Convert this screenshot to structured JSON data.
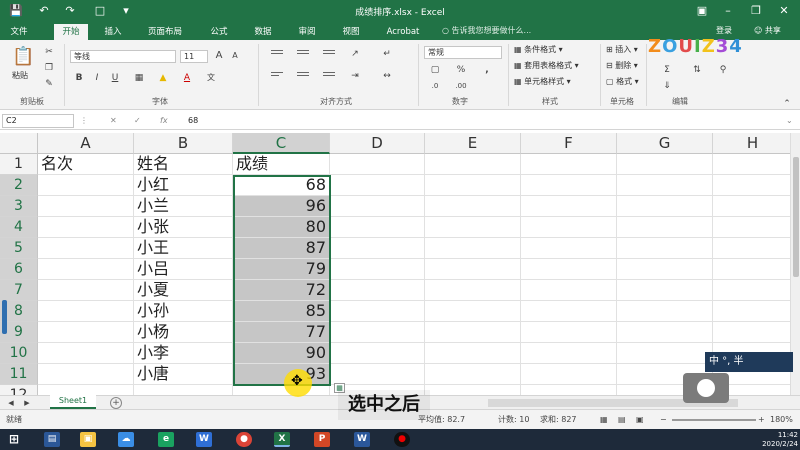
{
  "window": {
    "title": "成绩排序.xlsx - Excel",
    "quick_access": [
      "save-icon",
      "undo-icon",
      "redo-icon",
      "new-doc-icon",
      "customize-icon"
    ],
    "controls": [
      "ribbon-display-icon",
      "minimize-icon",
      "restore-icon",
      "close-icon"
    ]
  },
  "tabs": {
    "items": [
      "文件",
      "开始",
      "插入",
      "页面布局",
      "公式",
      "数据",
      "审阅",
      "视图",
      "Acrobat"
    ],
    "active": "开始",
    "tell_me": "告诉我您想要做什么...",
    "login": "登录",
    "share": "共享"
  },
  "ribbon": {
    "paste_label": "粘贴",
    "clipboard_label": "剪贴板",
    "font_name": "等线",
    "font_size": "11",
    "font_group_label": "字体",
    "bold": "B",
    "italic": "I",
    "underline": "U",
    "grow_font": "A",
    "shrink_font": "A",
    "font_color": "A",
    "alignment_label": "对齐方式",
    "number_format": "常规",
    "number_label": "数字",
    "percent": "%",
    "comma": ",",
    "cond_format": "条件格式",
    "table_format": "套用表格格式",
    "cell_styles": "单元格样式",
    "styles_label": "样式",
    "insert": "插入",
    "delete": "删除",
    "format": "格式",
    "cells_label": "单元格",
    "editing_label": "编辑",
    "accent_color": "#217346"
  },
  "logo": "ZOUIZ34",
  "formula_bar": {
    "name_box": "C2",
    "cancel": "✕",
    "enter": "✓",
    "fx": "fx",
    "value": "68"
  },
  "sheet": {
    "columns": [
      "A",
      "B",
      "C",
      "D",
      "E",
      "F",
      "G",
      "H"
    ],
    "selected_column": "C",
    "rows": [
      "1",
      "2",
      "3",
      "4",
      "5",
      "6",
      "7",
      "8",
      "9",
      "10",
      "11",
      "12"
    ],
    "header_row": [
      "名次",
      "姓名",
      "成绩"
    ],
    "data": [
      {
        "name": "小红",
        "score": "68"
      },
      {
        "name": "小兰",
        "score": "96"
      },
      {
        "name": "小张",
        "score": "80"
      },
      {
        "name": "小王",
        "score": "87"
      },
      {
        "name": "小吕",
        "score": "79"
      },
      {
        "name": "小夏",
        "score": "72"
      },
      {
        "name": "小孙",
        "score": "85"
      },
      {
        "name": "小杨",
        "score": "77"
      },
      {
        "name": "小李",
        "score": "90"
      },
      {
        "name": "小唐",
        "score": "93"
      }
    ],
    "selection": "C2:C11"
  },
  "sheet_tabs": {
    "items": [
      "Sheet1"
    ],
    "active": "Sheet1"
  },
  "status": {
    "mode": "就绪",
    "average": "平均值: 82.7",
    "count": "计数: 10",
    "sum": "求和: 827",
    "zoom": "180%",
    "zoom_minus": "−",
    "zoom_plus": "+"
  },
  "overlay": {
    "subtitle": "选中之后",
    "ime": "中 °, 半"
  },
  "taskbar": {
    "apps": [
      "start",
      "explorer",
      "baidu-netdisk",
      "ie",
      "wps",
      "chrome",
      "excel",
      "powerpoint",
      "word",
      "recorder"
    ],
    "active": "excel",
    "date": "2020/2/24",
    "time": "11:42"
  }
}
